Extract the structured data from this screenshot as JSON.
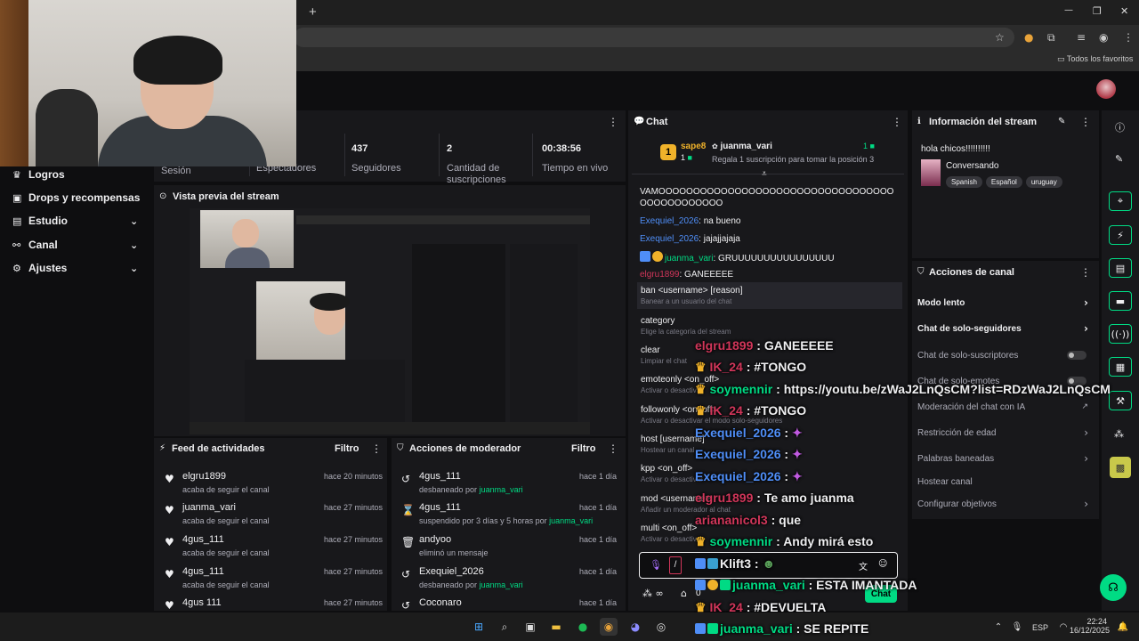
{
  "browser": {
    "new_tab": "+",
    "minimize": "—",
    "restore": "❐",
    "close": "✕",
    "bookmarks_folder": "Todos los favoritos"
  },
  "sidebar": {
    "items": [
      {
        "label": "Logros",
        "icon": "trophy-icon",
        "chevron": false
      },
      {
        "label": "Drops y recompensas",
        "icon": "gift-icon",
        "chevron": false
      },
      {
        "label": "Estudio",
        "icon": "studio-icon",
        "chevron": true
      },
      {
        "label": "Canal",
        "icon": "channel-icon",
        "chevron": true
      },
      {
        "label": "Ajustes",
        "icon": "gear-icon",
        "chevron": true
      }
    ]
  },
  "stats": {
    "items": [
      {
        "value": "",
        "label": "Sesión"
      },
      {
        "value": "",
        "label": "Espectadores"
      },
      {
        "value": "437",
        "label": "Seguidores"
      },
      {
        "value": "2",
        "label": "Cantidad de suscripciones"
      },
      {
        "value": "00:38:56",
        "label": "Tiempo en vivo"
      }
    ]
  },
  "preview": {
    "title": "Vista previa del stream"
  },
  "feed": {
    "title": "Feed de actividades",
    "filter": "Filtro",
    "rows": [
      {
        "user": "elgru1899",
        "desc": "acaba de seguir el canal",
        "time": "hace 20 minutos"
      },
      {
        "user": "juanma_vari",
        "desc": "acaba de seguir el canal",
        "time": "hace 27 minutos"
      },
      {
        "user": "4gus_111",
        "desc": "acaba de seguir el canal",
        "time": "hace 27 minutos"
      },
      {
        "user": "4gus_111",
        "desc": "acaba de seguir el canal",
        "time": "hace 27 minutos"
      },
      {
        "user": "4gus 111",
        "desc": "",
        "time": "hace 27 minutos"
      }
    ]
  },
  "mod": {
    "title": "Acciones de moderador",
    "filter": "Filtro",
    "rows": [
      {
        "user": "4gus_111",
        "desc": "desbaneado por ",
        "by": "juanma_vari",
        "time": "hace 1 día",
        "icon": "undo-icon"
      },
      {
        "user": "4gus_111",
        "desc": "suspendido por 3 días y 5 horas por ",
        "by": "juanma_vari",
        "time": "hace 1 día",
        "icon": "hourglass-icon"
      },
      {
        "user": "andyoo",
        "desc": "eliminó un mensaje",
        "by": "",
        "time": "hace 1 día",
        "icon": "trash-icon"
      },
      {
        "user": "Exequiel_2026",
        "desc": "desbaneado por ",
        "by": "juanma_vari",
        "time": "hace 1 día",
        "icon": "undo-icon"
      },
      {
        "user": "Coconaro",
        "desc": "",
        "by": "",
        "time": "hace 1 día",
        "icon": "undo-icon"
      }
    ]
  },
  "chat": {
    "title": "Chat",
    "pinned": {
      "rank_badge": "1",
      "user1": "sape8",
      "count1": "1",
      "user2": "juanma_vari",
      "count2": "1",
      "text": "Regala 1 suscripción para tomar la posición 3"
    },
    "messages": [
      {
        "user": "",
        "text": "VAMOOOOOOOOOOOOOOOOOOOOOOOOOOOOOOOOOOOOOOOOOOOOOO",
        "color": "#efeff1"
      },
      {
        "user": "Exequiel_2026",
        "text": ": na bueno",
        "color": "#4f8ef7"
      },
      {
        "user": "Exequiel_2026",
        "text": ": jajajjajaja",
        "color": "#4f8ef7"
      },
      {
        "user": "juanma_vari",
        "text": ": GRUUUUUUUUUUUUUUUU",
        "color": "#00db84"
      },
      {
        "user": "elgru1899",
        "text": ": GANEEEEE",
        "color": "#d1365a"
      }
    ],
    "commands": [
      {
        "name": "ban <username> [reason]",
        "help": "Banear a un usuario del chat"
      },
      {
        "name": "category",
        "help": "Elige la categoría del stream"
      },
      {
        "name": "clear",
        "help": "Limpiar el chat"
      },
      {
        "name": "emoteonly <on_off>",
        "help": "Activar o desactivar"
      },
      {
        "name": "followonly <on_off>",
        "help": "Activar o desactivar el modo solo-seguidores"
      },
      {
        "name": "host [username]",
        "help": "Hostear un canal"
      },
      {
        "name": "kpp <on_off>",
        "help": "Activar o desactivar"
      },
      {
        "name": "mod <username>",
        "help": "Añadir un moderador al chat"
      },
      {
        "name": "multi <on_off>",
        "help": "Activar o desactivar"
      }
    ],
    "input_value": "/",
    "send_label": "Chat",
    "footer_count": "0"
  },
  "overlay": [
    {
      "user": "elgru1899",
      "text": " : GANEEEEE",
      "color": "#d1365a",
      "badges": []
    },
    {
      "user": "IK_24",
      "text": " : #TONGO",
      "color": "#d1365a",
      "badges": [
        "crown"
      ]
    },
    {
      "user": "soymennir",
      "text": " : https://youtu.be/zWaJ2LnQsCM?list=RDzWaJ2LnQsCM",
      "color": "#00db84",
      "badges": [
        "crown"
      ]
    },
    {
      "user": "IK_24",
      "text": " : #TONGO",
      "color": "#d1365a",
      "badges": [
        "crown"
      ]
    },
    {
      "user": "Exequiel_2026",
      "text": " : ",
      "color": "#4f8ef7",
      "badges": []
    },
    {
      "user": "Exequiel_2026",
      "text": " : ",
      "color": "#4f8ef7",
      "badges": []
    },
    {
      "user": "Exequiel_2026",
      "text": " : ",
      "color": "#4f8ef7",
      "badges": []
    },
    {
      "user": "elgru1899",
      "text": " : Te amo juanma",
      "color": "#d1365a",
      "badges": []
    },
    {
      "user": "ariananicol3",
      "text": " : que",
      "color": "#d1365a",
      "badges": []
    },
    {
      "user": "soymennir",
      "text": " : Andy mirá esto",
      "color": "#00db84",
      "badges": [
        "crown"
      ]
    },
    {
      "user": "Klift3",
      "text": " : ",
      "color": "#efeff1",
      "badges": [
        "arrow",
        "cube"
      ]
    },
    {
      "user": "juanma_vari",
      "text": " : ESTA IMANTADA",
      "color": "#00db84",
      "badges": [
        "arrow",
        "coin",
        "grid"
      ]
    },
    {
      "user": "IK_24",
      "text": " : #DEVUELTA",
      "color": "#d1365a",
      "badges": [
        "crown"
      ]
    },
    {
      "user": "juanma_vari",
      "text": " : SE REPITE",
      "color": "#00db84",
      "badges": [
        "arrow",
        "grid"
      ]
    }
  ],
  "info": {
    "title": "Información del stream",
    "stream_title": "hola chicos!!!!!!!!!!",
    "category": "Conversando",
    "tags": [
      "Spanish",
      "Español",
      "uruguay"
    ]
  },
  "actions": {
    "title": "Acciones de canal",
    "items": [
      {
        "label": "Modo lento",
        "kind": "arrow",
        "bold": true
      },
      {
        "label": "Chat de solo-seguidores",
        "kind": "arrow",
        "bold": true
      },
      {
        "label": "Chat de solo-suscriptores",
        "kind": "toggle",
        "bold": false
      },
      {
        "label": "Chat de solo-emotes",
        "kind": "toggle",
        "bold": false
      },
      {
        "label": "Moderación del chat con IA",
        "kind": "external",
        "bold": false
      },
      {
        "label": "Restricción de edad",
        "kind": "arrow",
        "bold": false
      },
      {
        "label": "Palabras baneadas",
        "kind": "arrow",
        "bold": false
      },
      {
        "label": "Hostear canal",
        "kind": "none",
        "bold": false
      },
      {
        "label": "Configurar objetivos",
        "kind": "arrow",
        "bold": false
      }
    ]
  },
  "taskbar": {
    "lang": "ESP",
    "time": "22:24",
    "date": "16/12/2025"
  },
  "colors": {
    "accent": "#00db84",
    "panel": "#18181b",
    "bg": "#0e0e10"
  }
}
